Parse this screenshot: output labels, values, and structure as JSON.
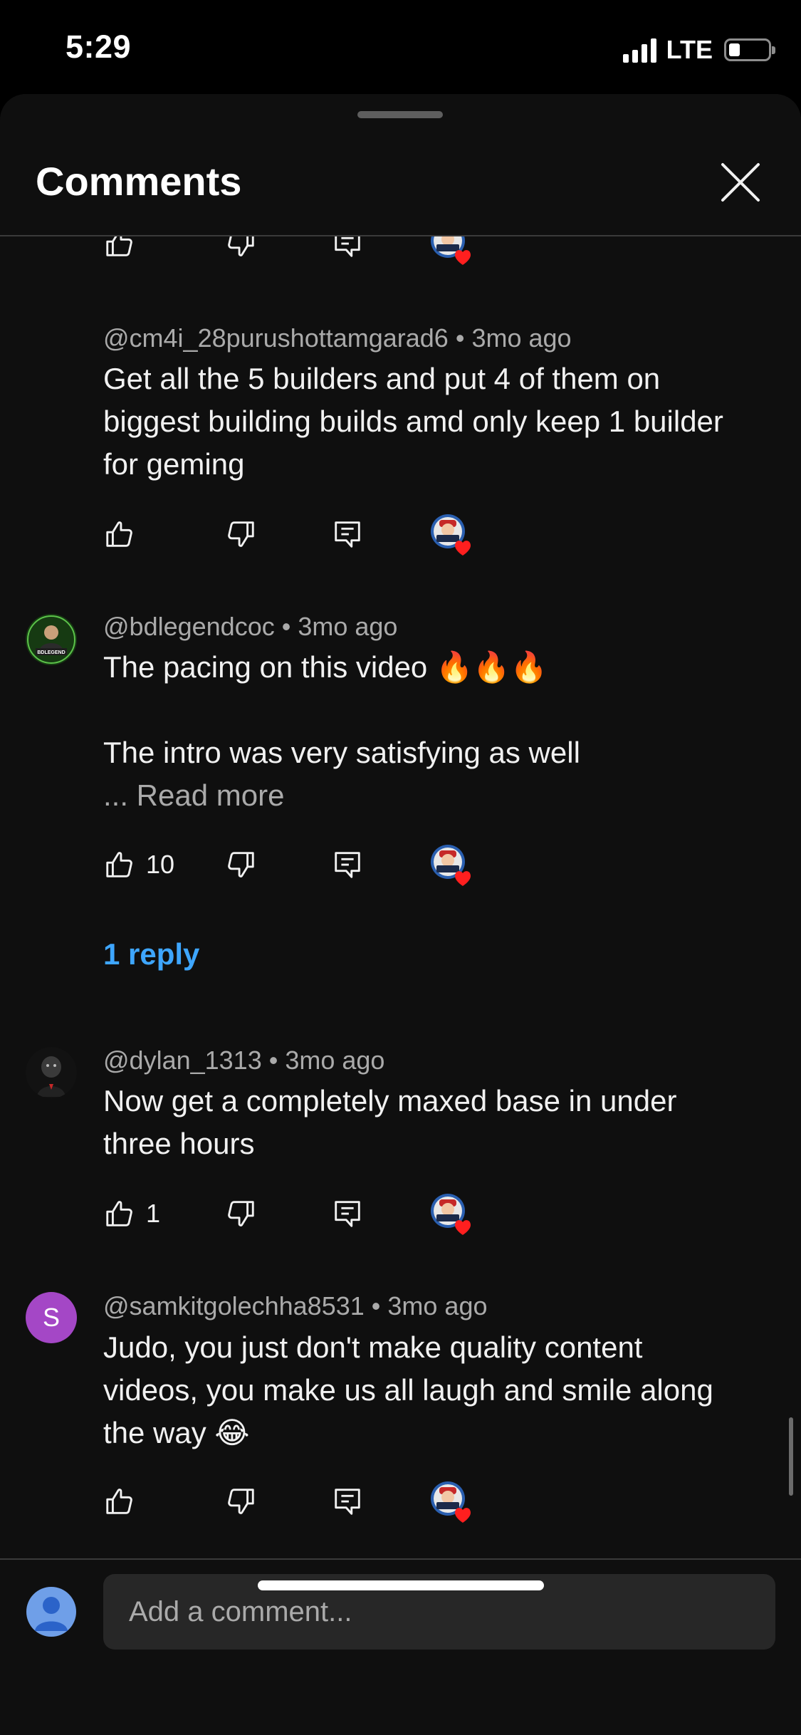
{
  "status_bar": {
    "time": "5:29",
    "network": "LTE"
  },
  "header": {
    "title": "Comments"
  },
  "comments": [
    {
      "author": "@cm4i_28purushottamgarad6",
      "time": "3mo ago",
      "text": "Get all the 5 builders and put 4 of them on biggest building builds amd only keep 1 builder for geming",
      "likes": ""
    },
    {
      "author": "@bdlegendcoc",
      "time": "3mo ago",
      "text_line1": "The pacing on this video 🔥🔥🔥",
      "text_line2": "The intro was very satisfying as well",
      "read_more": "... Read more",
      "likes": "10",
      "replies_label": "1 reply"
    },
    {
      "author": "@dylan_1313",
      "time": "3mo ago",
      "text": "Now get a completely maxed base in under three hours",
      "likes": "1"
    },
    {
      "author": "@samkitgolechha8531",
      "avatar_letter": "S",
      "time": "3mo ago",
      "text": "Judo, you just don't make quality content videos, you make us all laugh and smile along the way 😂",
      "likes": ""
    }
  ],
  "composer": {
    "placeholder": "Add a comment..."
  },
  "colors": {
    "background": "#0f0f0f",
    "link": "#3ea6ff",
    "heart": "#ff1f1f",
    "secondary_text": "#aaaaaa"
  }
}
